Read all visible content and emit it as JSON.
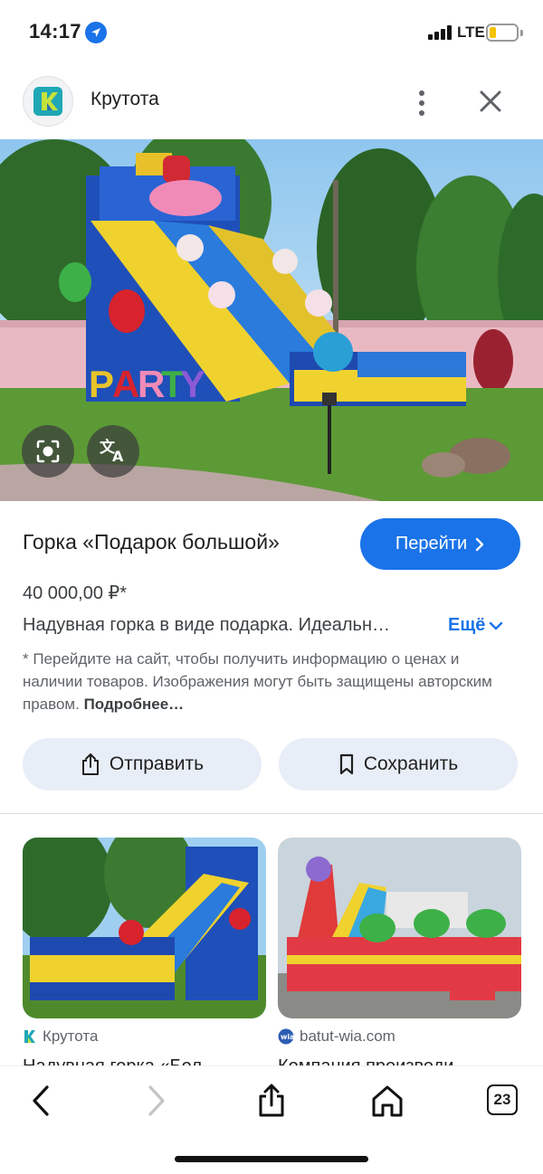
{
  "status_bar": {
    "time": "14:17",
    "network": "LTE",
    "battery_level": 0.25,
    "signal_bars": 4
  },
  "header": {
    "site_name": "Крутота",
    "logo_icon": "krutota-logo-icon",
    "more_icon": "more-vert-icon",
    "close_icon": "close-icon"
  },
  "image": {
    "overlay_buttons": [
      "lens-icon",
      "translate-icon"
    ]
  },
  "product": {
    "title": "Горка «Подарок большой»",
    "go_button": "Перейти",
    "price": "40 000,00 ₽*",
    "description": "Надувная горка в виде подарка. Идеальн…",
    "more_link": "Ещё",
    "disclaimer": "* Перейдите на сайт, чтобы получить информацию о ценах и наличии товаров. Изображения могут быть защищены авторским правом.",
    "disclaimer_link": "Подробнее…"
  },
  "actions": {
    "share_label": "Отправить",
    "save_label": "Сохранить"
  },
  "related": [
    {
      "source": "Крутота",
      "title": "Надувная горка «Бол…"
    },
    {
      "source": "batut-wia.com",
      "title": "Компания производи…"
    }
  ],
  "bottom_bar": {
    "tabs_count": "23",
    "icons": [
      "back-icon",
      "forward-icon",
      "share-icon",
      "home-icon",
      "tabs-icon"
    ]
  },
  "colors": {
    "accent": "#1a73e8",
    "button_bg": "#e8eef7",
    "battery": "#f5c400"
  }
}
